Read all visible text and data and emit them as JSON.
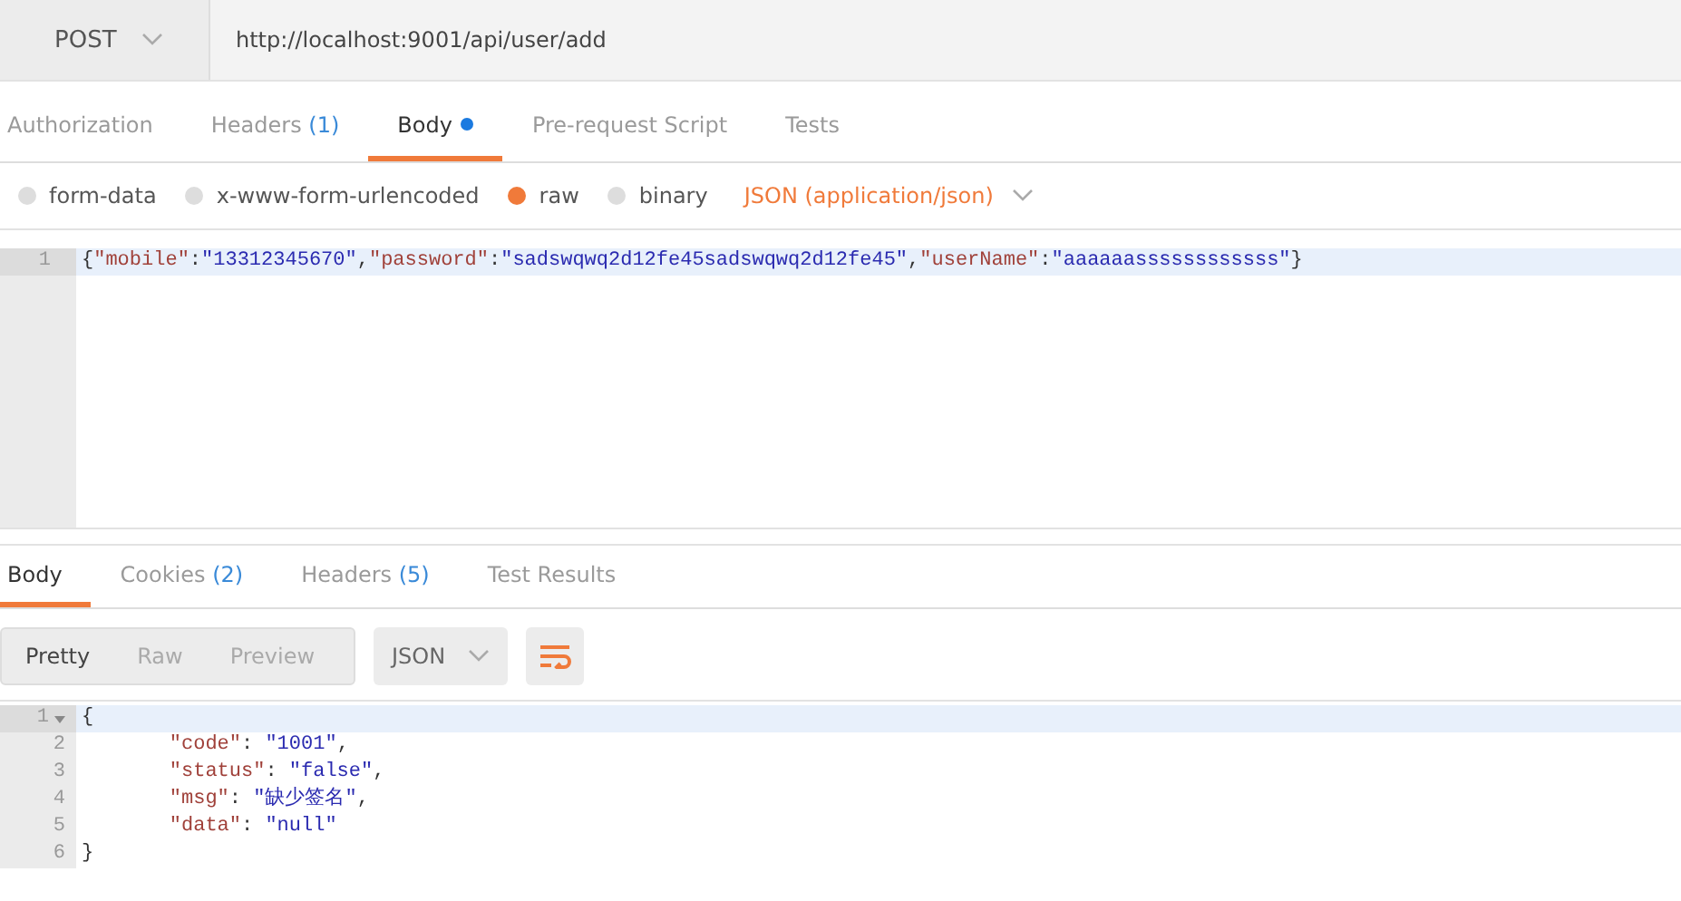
{
  "request": {
    "method": "POST",
    "url": "http://localhost:9001/api/user/add"
  },
  "request_tabs": [
    {
      "label": "Authorization",
      "selected": false
    },
    {
      "label": "Headers",
      "count": "(1)",
      "selected": false
    },
    {
      "label": "Body",
      "selected": true,
      "dot": true
    },
    {
      "label": "Pre-request Script",
      "selected": false
    },
    {
      "label": "Tests",
      "selected": false
    }
  ],
  "body_types": [
    {
      "label": "form-data",
      "selected": false
    },
    {
      "label": "x-www-form-urlencoded",
      "selected": false
    },
    {
      "label": "raw",
      "selected": true
    },
    {
      "label": "binary",
      "selected": false
    }
  ],
  "content_type": "JSON (application/json)",
  "request_body": [
    {
      "number": "1",
      "active": true,
      "tokens": [
        {
          "kind": "punct",
          "text": "{"
        },
        {
          "kind": "key",
          "text": "\"mobile\""
        },
        {
          "kind": "punct",
          "text": ":"
        },
        {
          "kind": "string",
          "text": "\"13312345670\""
        },
        {
          "kind": "punct",
          "text": ","
        },
        {
          "kind": "key",
          "text": "\"password\""
        },
        {
          "kind": "punct",
          "text": ":"
        },
        {
          "kind": "string",
          "text": "\"sadswqwq2d12fe45sadswqwq2d12fe45\""
        },
        {
          "kind": "punct",
          "text": ","
        },
        {
          "kind": "key",
          "text": "\"userName\""
        },
        {
          "kind": "punct",
          "text": ":"
        },
        {
          "kind": "string",
          "text": "\"aaaaaassssssssssss\""
        },
        {
          "kind": "punct",
          "text": "}"
        }
      ]
    }
  ],
  "response_tabs": [
    {
      "label": "Body",
      "selected": true
    },
    {
      "label": "Cookies",
      "count": "(2)",
      "selected": false
    },
    {
      "label": "Headers",
      "count": "(5)",
      "selected": false
    },
    {
      "label": "Test Results",
      "selected": false
    }
  ],
  "view_modes": [
    {
      "label": "Pretty",
      "selected": true
    },
    {
      "label": "Raw",
      "selected": false
    },
    {
      "label": "Preview",
      "selected": false
    }
  ],
  "format": "JSON",
  "response_body": [
    {
      "number": "1",
      "active": true,
      "foldable": true,
      "tokens": [
        {
          "kind": "punct",
          "text": "{"
        }
      ]
    },
    {
      "number": "2",
      "active": false,
      "indented": true,
      "tokens": [
        {
          "kind": "key",
          "text": "\"code\""
        },
        {
          "kind": "punct",
          "text": ": "
        },
        {
          "kind": "string",
          "text": "\"1001\""
        },
        {
          "kind": "punct",
          "text": ","
        }
      ]
    },
    {
      "number": "3",
      "active": false,
      "indented": true,
      "tokens": [
        {
          "kind": "key",
          "text": "\"status\""
        },
        {
          "kind": "punct",
          "text": ": "
        },
        {
          "kind": "string",
          "text": "\"false\""
        },
        {
          "kind": "punct",
          "text": ","
        }
      ]
    },
    {
      "number": "4",
      "active": false,
      "indented": true,
      "tokens": [
        {
          "kind": "key",
          "text": "\"msg\""
        },
        {
          "kind": "punct",
          "text": ": "
        },
        {
          "kind": "string",
          "text": "\"缺少签名\""
        },
        {
          "kind": "punct",
          "text": ","
        }
      ]
    },
    {
      "number": "5",
      "active": false,
      "indented": true,
      "tokens": [
        {
          "kind": "key",
          "text": "\"data\""
        },
        {
          "kind": "punct",
          "text": ": "
        },
        {
          "kind": "string",
          "text": "\"null\""
        }
      ]
    },
    {
      "number": "6",
      "active": false,
      "tokens": [
        {
          "kind": "punct",
          "text": "}"
        }
      ]
    }
  ]
}
